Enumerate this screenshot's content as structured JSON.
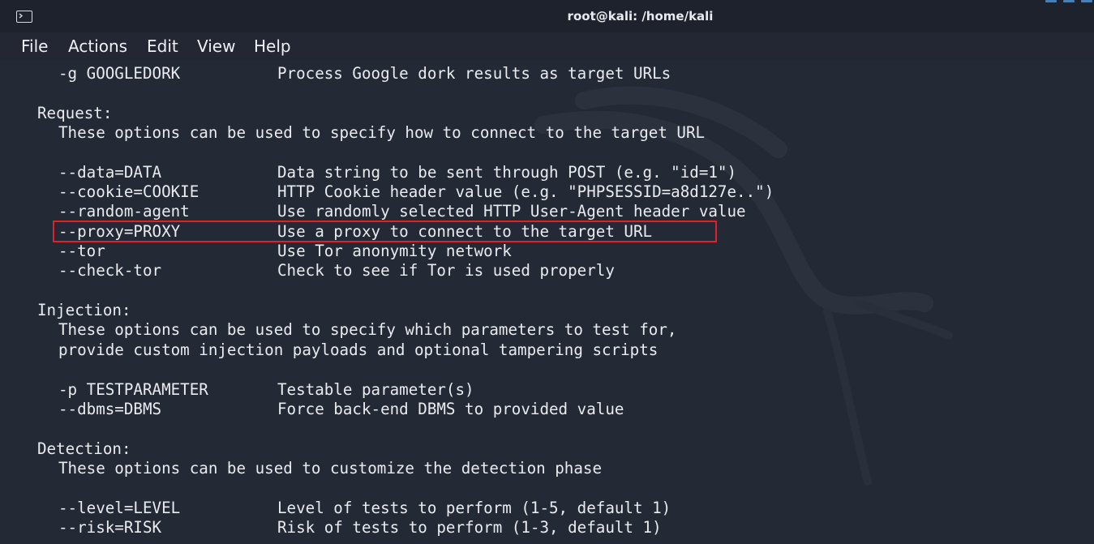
{
  "window": {
    "title": "root@kali: /home/kali"
  },
  "menu": {
    "file": "File",
    "actions": "Actions",
    "edit": "Edit",
    "view": "View",
    "help": "Help"
  },
  "colors": {
    "window_bg": "#222733",
    "terminal_bg": "#242a35",
    "text": "#e9ebef",
    "highlight_border": "#e0202a"
  },
  "icons": {
    "title_icon": "terminal-icon",
    "background": "kali-dragon-logo"
  },
  "terminal": {
    "googledork_option": "-g GOOGLEDORK",
    "googledork_desc": "Process Google dork results as target URLs",
    "request_heading": "Request:",
    "request_intro": "These options can be used to specify how to connect to the target URL",
    "data_option": "--data=DATA",
    "data_desc": "Data string to be sent through POST (e.g. \"id=1\")",
    "cookie_option": "--cookie=COOKIE",
    "cookie_desc": "HTTP Cookie header value (e.g. \"PHPSESSID=a8d127e..\")",
    "random_agent_option": "--random-agent",
    "random_agent_desc": "Use randomly selected HTTP User-Agent header value",
    "proxy_option": "--proxy=PROXY",
    "proxy_desc": "Use a proxy to connect to the target URL",
    "tor_option": "--tor",
    "tor_desc": "Use Tor anonymity network",
    "check_tor_option": "--check-tor",
    "check_tor_desc": "Check to see if Tor is used properly",
    "injection_heading": "Injection:",
    "injection_intro_1": "These options can be used to specify which parameters to test for,",
    "injection_intro_2": "provide custom injection payloads and optional tampering scripts",
    "testparameter_option": "-p TESTPARAMETER",
    "testparameter_desc": "Testable parameter(s)",
    "dbms_option": "--dbms=DBMS",
    "dbms_desc": "Force back-end DBMS to provided value",
    "detection_heading": "Detection:",
    "detection_intro": "These options can be used to customize the detection phase",
    "level_option": "--level=LEVEL",
    "level_desc": "Level of tests to perform (1-5, default 1)",
    "risk_option": "--risk=RISK",
    "risk_desc": "Risk of tests to perform (1-3, default 1)"
  }
}
